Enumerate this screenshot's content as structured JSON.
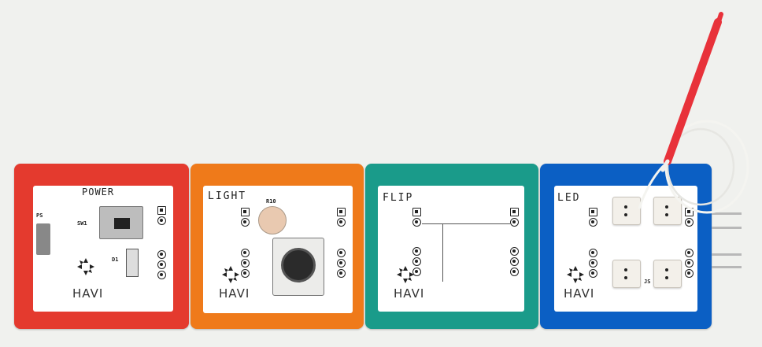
{
  "modules": [
    {
      "title": "POWER",
      "brand": "HAVI",
      "color": "#e43a2e",
      "labels": [
        "PS",
        "SW1",
        "D1"
      ]
    },
    {
      "title": "LIGHT",
      "brand": "HAVI",
      "color": "#ef7a1a",
      "labels": [
        "R10"
      ]
    },
    {
      "title": "FLIP",
      "brand": "HAVI",
      "color": "#1a9b8a",
      "labels": []
    },
    {
      "title": "LED",
      "brand": "HAVI",
      "color": "#0b5fc4",
      "labels": [
        "JS"
      ]
    }
  ],
  "colors": {
    "background": "#f0f1ee",
    "probe": "#e8323a",
    "cable": "#f4f4f0"
  },
  "icons": [
    "havi-logo-icon",
    "probe-pen-icon",
    "potentiometer-knob-icon",
    "light-sensor-icon",
    "slide-switch-icon",
    "usb-connector-icon"
  ]
}
